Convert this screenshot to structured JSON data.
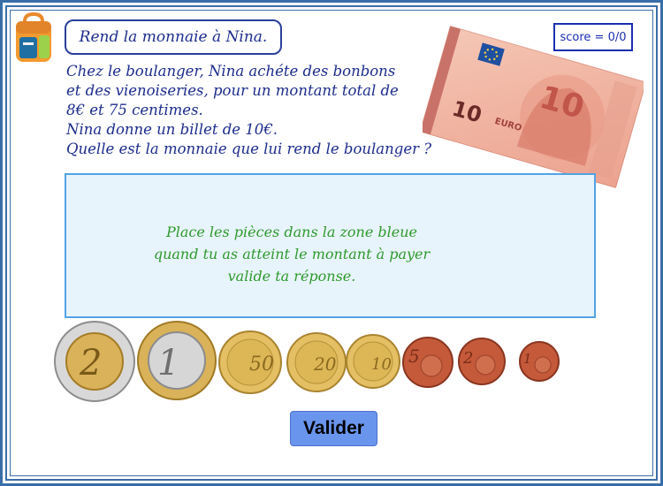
{
  "title": "Rend la monnaie à Nina.",
  "score": "score = 0/0",
  "problem_lines": [
    "Chez le boulanger,  Nina achéte des bonbons",
    "et des vienoiseries, pour un montant total de",
    "8€ et 75 centimes.",
    "Nina donne un billet de 10€.",
    "Quelle est la monnaie que lui rend le boulanger ?"
  ],
  "instructions": [
    "Place les pièces dans la zone bleue",
    "quand tu as atteint le montant à payer",
    "valide ta réponse."
  ],
  "banknote": {
    "value": "10",
    "currency_text": "EURO"
  },
  "coins": [
    {
      "label": "2",
      "kind": "bimetal-2"
    },
    {
      "label": "1",
      "kind": "bimetal-1"
    },
    {
      "label": "50",
      "kind": "gold"
    },
    {
      "label": "20",
      "kind": "gold"
    },
    {
      "label": "10",
      "kind": "gold"
    },
    {
      "label": "5",
      "kind": "copper"
    },
    {
      "label": "2",
      "kind": "copper"
    },
    {
      "label": "1",
      "kind": "copper"
    }
  ],
  "buttons": {
    "validate": "Valider"
  },
  "icons": {
    "bag": "school-bag-icon"
  },
  "colors": {
    "frame": "#3a6ea8",
    "title_text": "#1d2d8c",
    "instruction_text": "#2f9a2f",
    "dropzone_fill": "#e8f4fb",
    "dropzone_border": "#52a3e6",
    "button": "#6a95ec"
  }
}
